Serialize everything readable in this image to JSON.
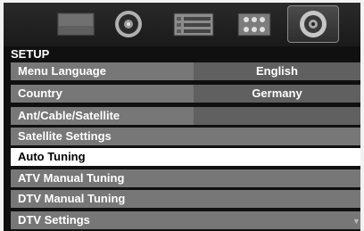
{
  "icon_bar": {
    "items": [
      {
        "icon": "picture-icon"
      },
      {
        "icon": "sound-icon"
      },
      {
        "icon": "preferences-icon"
      },
      {
        "icon": "features-icon"
      },
      {
        "icon": "setup-icon",
        "selected": true
      }
    ]
  },
  "setup": {
    "title": "SETUP",
    "rows": [
      {
        "label": "Menu Language",
        "value": "English"
      },
      {
        "label": "Country",
        "value": "Germany"
      },
      {
        "label": "Ant/Cable/Satellite",
        "value": ""
      },
      {
        "label": "Satellite Settings"
      },
      {
        "label": "Auto Tuning",
        "selected": true
      },
      {
        "label": "ATV Manual Tuning"
      },
      {
        "label": "DTV Manual Tuning"
      },
      {
        "label": "DTV Settings"
      }
    ]
  },
  "colors": {
    "row_background": "#777777",
    "value_background": "#606060",
    "selected_row": "#ffffff",
    "screen_background": "#101010"
  }
}
